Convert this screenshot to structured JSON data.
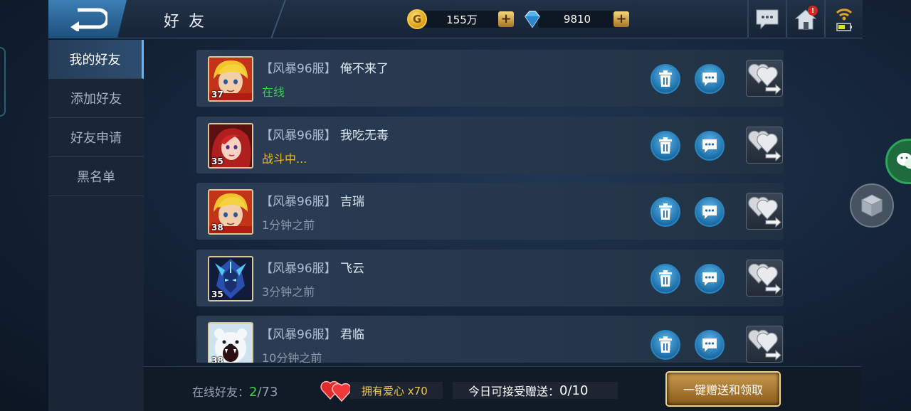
{
  "header": {
    "title": "好 友",
    "gold": "155万",
    "gems": "9810",
    "mail_badge": "!"
  },
  "sidebar": {
    "items": [
      {
        "label": "我的好友",
        "active": true
      },
      {
        "label": "添加好友"
      },
      {
        "label": "好友申请"
      },
      {
        "label": "黑名单"
      }
    ]
  },
  "friends": [
    {
      "server": "【风暴96服】",
      "name": "俺不来了",
      "level": "37",
      "status": "在线",
      "status_type": "online",
      "avatar": "blonde-hero"
    },
    {
      "server": "【风暴96服】",
      "name": "我吃无毒",
      "level": "35",
      "status": "战斗中...",
      "status_type": "battle",
      "avatar": "red-hair-girl"
    },
    {
      "server": "【风暴96服】",
      "name": "吉瑞",
      "level": "38",
      "status": "1分钟之前",
      "status_type": "offline",
      "avatar": "blonde-hero"
    },
    {
      "server": "【风暴96服】",
      "name": "飞云",
      "level": "35",
      "status": "3分钟之前",
      "status_type": "offline",
      "avatar": "blue-knight"
    },
    {
      "server": "【风暴96服】",
      "name": "君临",
      "level": "38",
      "status": "10分钟之前",
      "status_type": "offline",
      "avatar": "polar-bear"
    }
  ],
  "footer": {
    "online_label": "在线好友：",
    "online_count": "2",
    "online_total": "/73",
    "love": "拥有爱心 x70",
    "receive_label": "今日可接受赠送：",
    "receive_value": "0/10",
    "one_click": "一键赠送和领取"
  },
  "colors": {
    "online": "#34d04a",
    "battle": "#f2b822",
    "accent": "#5db4ff"
  }
}
